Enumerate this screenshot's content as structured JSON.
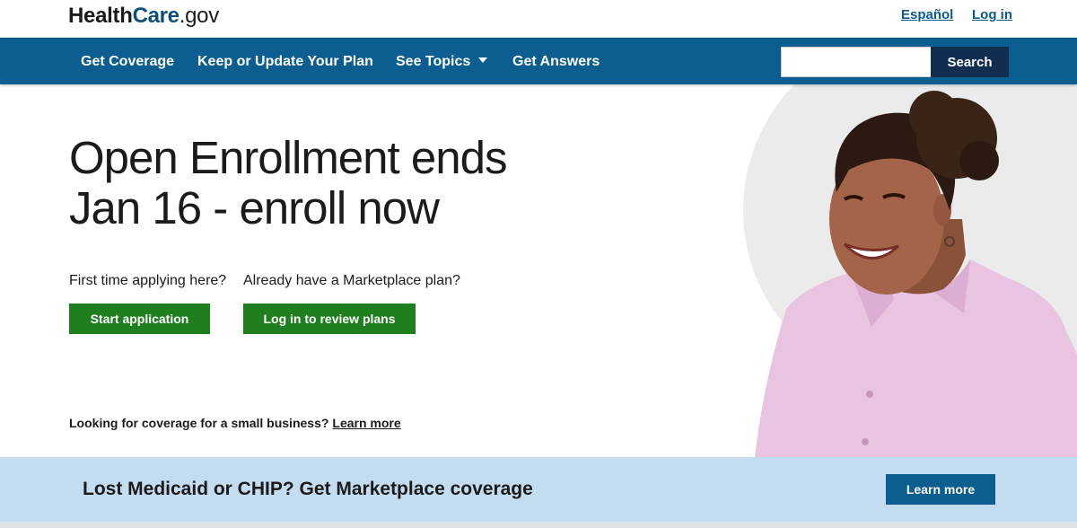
{
  "header": {
    "logo": {
      "part1": "Health",
      "part2": "Care",
      "part3": ".gov"
    },
    "links": {
      "espanol": "Español",
      "login": "Log in"
    }
  },
  "nav": {
    "items": [
      {
        "label": "Get Coverage"
      },
      {
        "label": "Keep or Update Your Plan"
      },
      {
        "label": "See Topics"
      },
      {
        "label": "Get Answers"
      }
    ],
    "search": {
      "value": "",
      "placeholder": "",
      "button_label": "Search"
    }
  },
  "hero": {
    "headline_line1": "Open Enrollment ends",
    "headline_line2": "Jan 16 - enroll now",
    "question_first": "First time applying here?",
    "question_existing": "Already have a Marketplace plan?",
    "start_button": "Start application",
    "login_review_button": "Log in to review plans",
    "small_business_text": "Looking for coverage for a small business?",
    "small_business_link": "Learn more"
  },
  "banner": {
    "text": "Lost Medicaid or CHIP? Get Marketplace coverage",
    "button": "Learn more"
  },
  "colors": {
    "nav_bg": "#0b5e8f",
    "search_button": "#112e51",
    "primary_green": "#1f7f1f",
    "banner_bg": "#c4dcef",
    "link_blue": "#0b5a8e"
  }
}
